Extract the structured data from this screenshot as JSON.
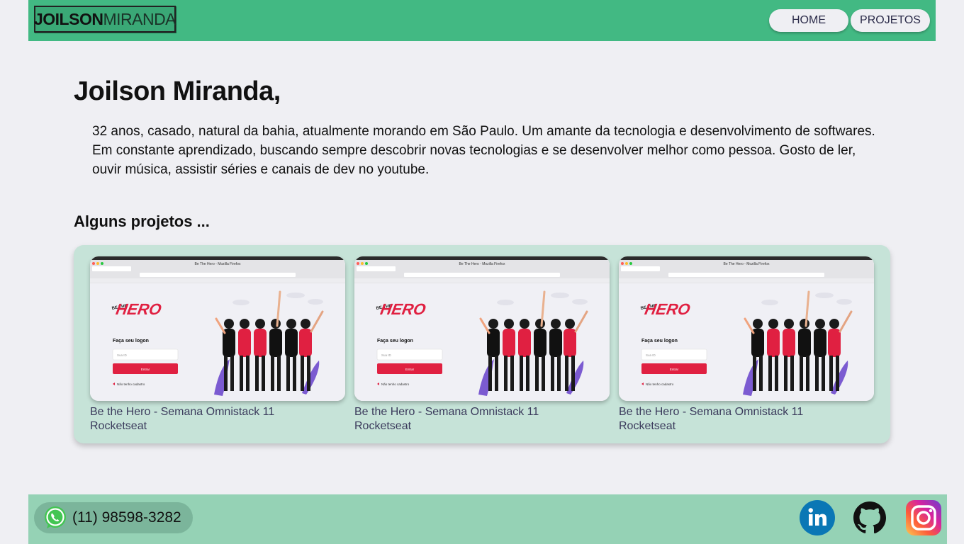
{
  "header": {
    "logo_bold": "JOILSON",
    "logo_light": "MIRANDA",
    "nav": [
      {
        "label": "HOME"
      },
      {
        "label": "PROJETOS"
      }
    ]
  },
  "intro": {
    "title": "Joilson Miranda,",
    "bio": "32 anos, casado, natural da bahia, atualmente morando em São Paulo. Um amante da tecnologia e desenvolvimento de softwares. Em constante aprendizado, buscando sempre descobrir novas tecnologias e se desenvolver melhor como pessoa. Gosto de ler, ouvir música, assistir séries e canais de dev no youtube."
  },
  "projects": {
    "section_title": "Alguns projetos ...",
    "items": [
      {
        "title": "Be the Hero - Semana Omnistack 11",
        "subtitle": "Rocketseat",
        "screenshot": {
          "window_title": "Be The Hero - Mozilla Firefox",
          "brand_top": "BE THE",
          "brand": "HERO",
          "heading": "Faça seu logon",
          "input_placeholder": "Sua ID",
          "button": "Entrar",
          "link": "Não tenho cadastro"
        }
      },
      {
        "title": "Be the Hero - Semana Omnistack 11",
        "subtitle": "Rocketseat",
        "screenshot": {
          "window_title": "Be The Hero - Mozilla Firefox",
          "brand_top": "BE THE",
          "brand": "HERO",
          "heading": "Faça seu logon",
          "input_placeholder": "Sua ID",
          "button": "Entrar",
          "link": "Não tenho cadastro"
        }
      },
      {
        "title": "Be the Hero - Semana Omnistack 11",
        "subtitle": "Rocketseat",
        "screenshot": {
          "window_title": "Be The Hero - Mozilla Firefox",
          "brand_top": "BE THE",
          "brand": "HERO",
          "heading": "Faça seu logon",
          "input_placeholder": "Sua ID",
          "button": "Entrar",
          "link": "Não tenho cadastro"
        }
      }
    ]
  },
  "footer": {
    "phone": "(11) 98598-3282",
    "icons": [
      "whatsapp-icon",
      "linkedin-icon",
      "github-icon",
      "instagram-icon"
    ]
  },
  "colors": {
    "header_bg": "#42b983",
    "footer_bg": "#95d2b5",
    "projects_bg": "#c6e3d8",
    "brand_red": "#e02041"
  }
}
